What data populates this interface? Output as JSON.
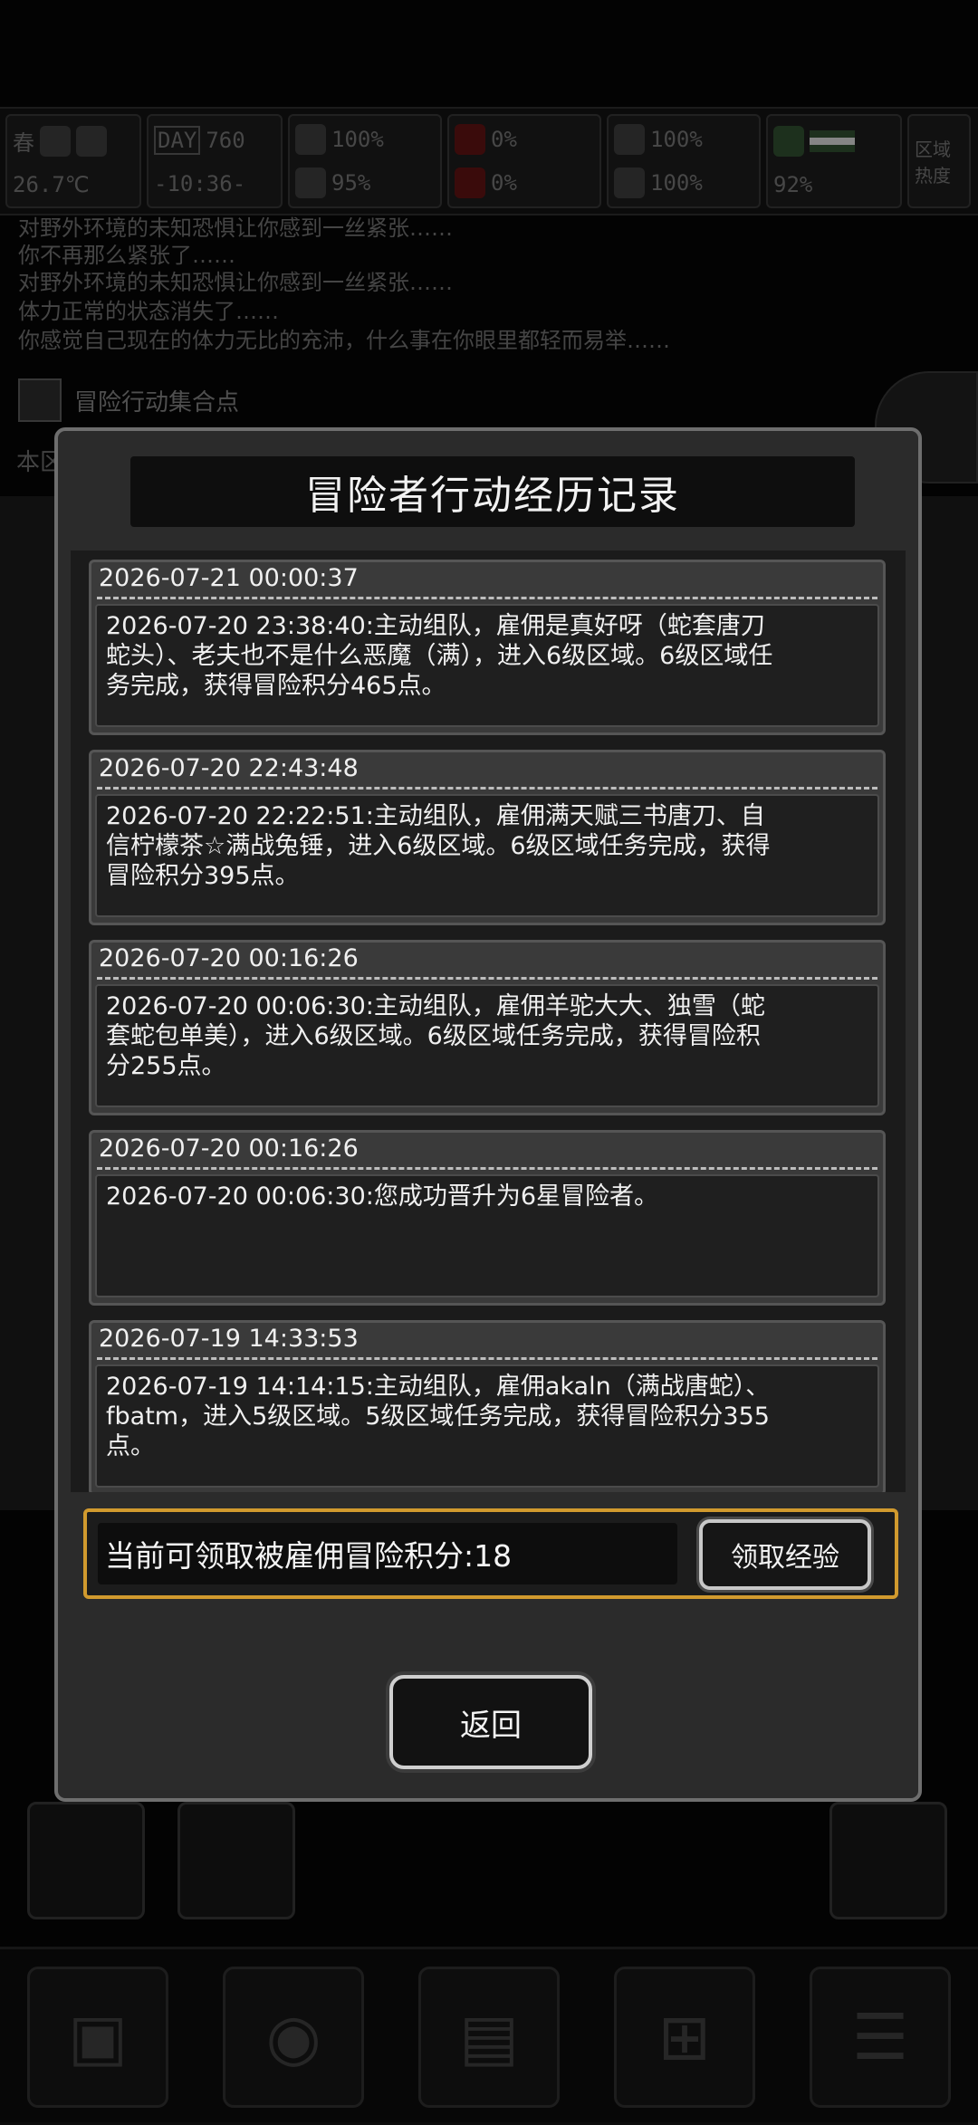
{
  "status_bar": {
    "season": "春",
    "day_label": "DAY",
    "day_number": "760",
    "temperature": "26.7℃",
    "clock": "-10:36-",
    "stat_1": "100%",
    "stat_2": "0%",
    "stat_3": "100%",
    "stat_4": "95%",
    "stat_5": "0%",
    "stat_6": "100%",
    "stat_7": "92%",
    "region_heat_label": "区域热度"
  },
  "background_log": [
    "对野外环境的未知恐惧让你感到一丝紧张……",
    "你不再那么紧张了……",
    "对野外环境的未知恐惧让你感到一丝紧张……",
    "体力正常的状态消失了……",
    "你感觉自己现在的体力无比的充沛，什么事在你眼里都轻而易举……"
  ],
  "background_location": "冒险行动集合点",
  "background_area_label": "本区",
  "modal": {
    "title": "冒险者行动经历记录",
    "entries": [
      {
        "time": "2026-07-21 00:00:37",
        "text": "2026-07-20 23:38:40:主动组队，雇佣是真好呀（蛇套唐刀蛇头）、老夫也不是什么恶魔（满），进入6级区域。6级区域任务完成，获得冒险积分465点。"
      },
      {
        "time": "2026-07-20 22:43:48",
        "text": "2026-07-20 22:22:51:主动组队，雇佣满天赋三书唐刀、自信柠檬茶☆满战兔锤，进入6级区域。6级区域任务完成，获得冒险积分395点。"
      },
      {
        "time": "2026-07-20 00:16:26",
        "text": "2026-07-20 00:06:30:主动组队，雇佣羊驼大大、独雪（蛇套蛇包单美），进入6级区域。6级区域任务完成，获得冒险积分255点。"
      },
      {
        "time": "2026-07-20 00:16:26",
        "text": "2026-07-20 00:06:30:您成功晋升为6星冒险者。"
      },
      {
        "time": "2026-07-19 14:33:53",
        "text": "2026-07-19 14:14:15:主动组队，雇佣akaln（满战唐蛇）、fbatm，进入5级区域。5级区域任务完成，获得冒险积分355点。"
      }
    ],
    "claim_text": "当前可领取被雇佣冒险积分:18",
    "claim_button": "领取经验",
    "return_button": "返回"
  },
  "toolbar_icons": [
    "backpack-icon",
    "brain-icon",
    "journal-icon",
    "cart-icon",
    "menu-icon"
  ]
}
